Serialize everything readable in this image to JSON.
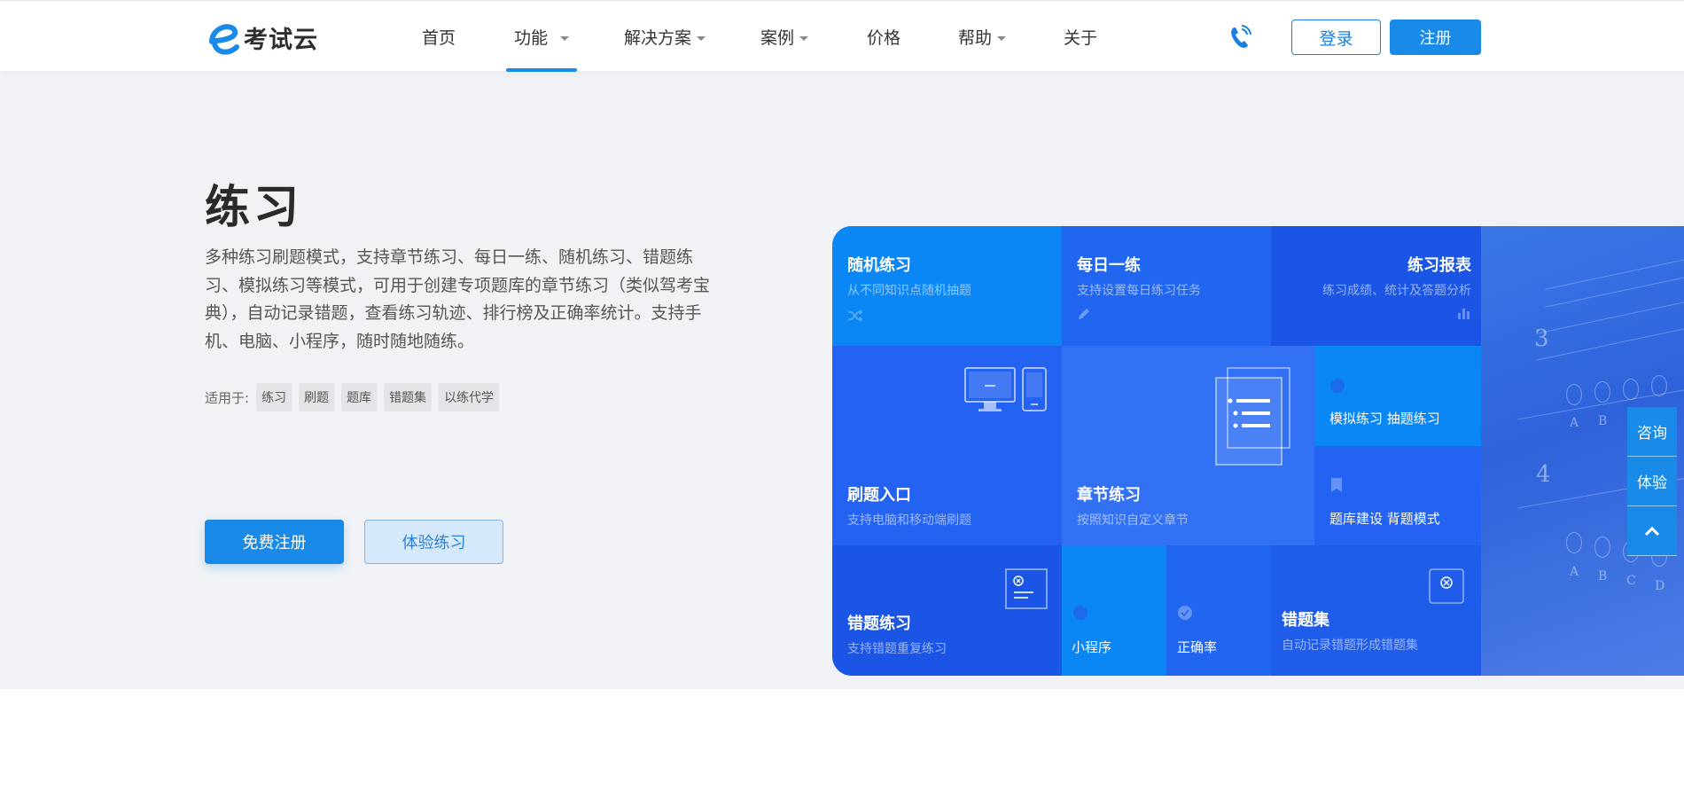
{
  "header": {
    "logo_text": "考试云",
    "nav": [
      {
        "label": "首页"
      },
      {
        "label": "功能"
      },
      {
        "label": "解决方案"
      },
      {
        "label": "案例"
      },
      {
        "label": "价格"
      },
      {
        "label": "帮助"
      },
      {
        "label": "关于"
      }
    ],
    "active_nav": "功能",
    "login_label": "登录",
    "register_label": "注册"
  },
  "hero": {
    "title": "练习",
    "description": "多种练习刷题模式，支持章节练习、每日一练、随机练习、错题练习、模拟练习等模式，可用于创建专项题库的章节练习（类似驾考宝典），自动记录错题，查看练习轨迹、排行榜及正确率统计。支持手机、电脑、小程序，随时随地随练。",
    "tags_label": "适用于:",
    "tags": [
      "练习",
      "刷题",
      "题库",
      "错题集",
      "以练代学"
    ],
    "free_register_label": "免费注册",
    "try_label": "体验练习"
  },
  "features": {
    "random": {
      "title": "随机练习",
      "sub": "从不同知识点随机抽题"
    },
    "daily": {
      "title": "每日一练",
      "sub": "支持设置每日练习任务"
    },
    "report": {
      "title": "练习报表",
      "sub": "练习成绩、统计及答题分析"
    },
    "entry": {
      "title": "刷题入口",
      "sub": "支持电脑和移动端刷题"
    },
    "chapter": {
      "title": "章节练习",
      "sub": "按照知识自定义章节"
    },
    "mock": {
      "title": "模拟练习 抽题练习"
    },
    "bank": {
      "title": "题库建设 背题模式"
    },
    "wrong": {
      "title": "错题练习",
      "sub": "支持错题重复练习"
    },
    "mini": {
      "title": "小程序"
    },
    "accuracy": {
      "title": "正确率"
    },
    "wrongset": {
      "title": "错题集",
      "sub": "自动记录错题形成错题集"
    }
  },
  "side": {
    "consult": "咨询",
    "experience": "体验",
    "top_icon": "chevron-up-icon"
  },
  "colors": {
    "primary": "#1a8ae8",
    "hero_bg": "#f0f2f5"
  }
}
